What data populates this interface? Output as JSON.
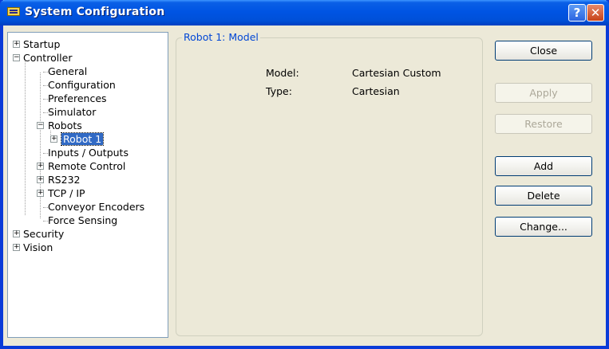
{
  "window": {
    "title": "System Configuration"
  },
  "tree": {
    "items": [
      {
        "label": "Startup"
      },
      {
        "label": "Controller"
      },
      {
        "label": "General"
      },
      {
        "label": "Configuration"
      },
      {
        "label": "Preferences"
      },
      {
        "label": "Simulator"
      },
      {
        "label": "Robots"
      },
      {
        "label": "Robot 1"
      },
      {
        "label": "Inputs / Outputs"
      },
      {
        "label": "Remote Control"
      },
      {
        "label": "RS232"
      },
      {
        "label": "TCP / IP"
      },
      {
        "label": "Conveyor Encoders"
      },
      {
        "label": "Force Sensing"
      },
      {
        "label": "Security"
      },
      {
        "label": "Vision"
      }
    ]
  },
  "panel": {
    "group_title": "Robot 1: Model",
    "model_label": "Model:",
    "model_value": "Cartesian Custom",
    "type_label": "Type:",
    "type_value": "Cartesian"
  },
  "buttons": {
    "close": "Close",
    "apply": "Apply",
    "restore": "Restore",
    "add": "Add",
    "delete": "Delete",
    "change": "Change..."
  }
}
